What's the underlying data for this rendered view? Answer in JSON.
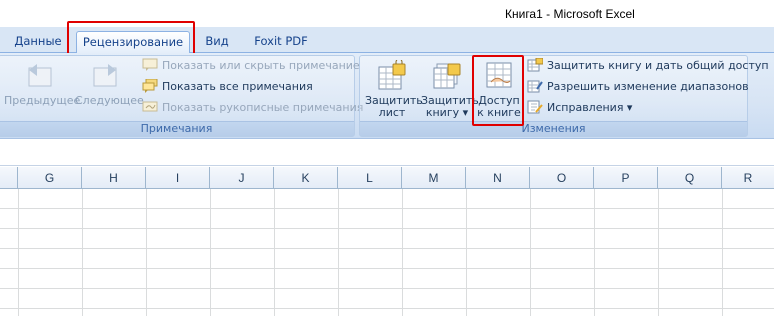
{
  "window": {
    "title": "Книга1 - Microsoft Excel"
  },
  "tabs": [
    {
      "label": "Данные",
      "active": false
    },
    {
      "label": "Рецензирование",
      "active": true
    },
    {
      "label": "Вид",
      "active": false
    },
    {
      "label": "Foxit PDF",
      "active": false
    }
  ],
  "groups": {
    "comments": {
      "label": "Примечания",
      "prev": "Предыдущее",
      "next": "Следующее",
      "show_hide": "Показать или скрыть примечание",
      "show_all": "Показать все примечания",
      "show_ink": "Показать рукописные примечания"
    },
    "changes": {
      "label": "Изменения",
      "protect_sheet": [
        "Защитить",
        "лист"
      ],
      "protect_book": [
        "Защитить",
        "книгу ▾"
      ],
      "share_book": [
        "Доступ",
        "к книге"
      ],
      "protect_share": "Защитить книгу и дать общий доступ",
      "allow_ranges": "Разрешить изменение диапазонов",
      "track_changes": "Исправления ▾"
    }
  },
  "columns": [
    "G",
    "H",
    "I",
    "J",
    "K",
    "L",
    "M",
    "N",
    "O",
    "P",
    "Q",
    "R"
  ],
  "colors": {
    "highlight": "#e00000",
    "ribbon": "#dbe6f4",
    "tabstrip": "#d9e6f5"
  }
}
